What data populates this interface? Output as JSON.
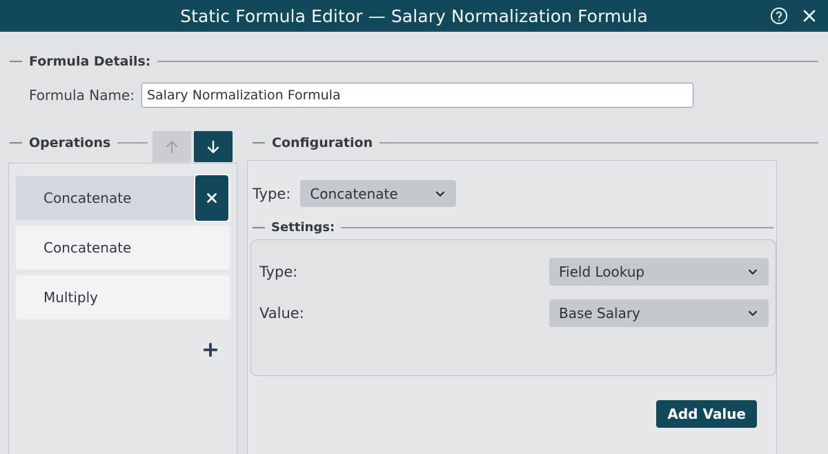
{
  "titlebar": {
    "title": "Static Formula Editor — Salary Normalization Formula",
    "help_icon": "help-circle-icon",
    "close_icon": "close-icon",
    "background": "#11495a",
    "text_color": "#f4f7f8"
  },
  "formula_details": {
    "group_label": "Formula Details:",
    "name_label": "Formula Name:",
    "name_value": "Salary Normalization Formula",
    "name_placeholder": "Formula Name"
  },
  "operations": {
    "group_label": "Operations",
    "move_up": {
      "icon": "arrow-up-icon",
      "enabled": false,
      "background": "#cbcdd0",
      "color": "#9ba1a8"
    },
    "move_down": {
      "icon": "arrow-down-icon",
      "enabled": true,
      "background": "#11495a",
      "color": "#ffffff"
    },
    "items": [
      {
        "label": "Concatenate",
        "selected": true
      },
      {
        "label": "Concatenate",
        "selected": false
      },
      {
        "label": "Multiply",
        "selected": false
      }
    ],
    "delete_icon": "close-icon",
    "add_icon": "plus-icon",
    "selected_background": "#d3d8e0",
    "item_background": "#f2f3f4"
  },
  "configuration": {
    "group_label": "Configuration",
    "type_label": "Type:",
    "type_value": "Concatenate",
    "type_chevron": "chevron-down-icon",
    "settings": {
      "group_label": "Settings:",
      "rows": [
        {
          "label": "Type:",
          "value": "Field Lookup",
          "chevron": "chevron-down-icon"
        },
        {
          "label": "Value:",
          "value": "Base Salary",
          "chevron": "chevron-down-icon"
        }
      ]
    },
    "add_value_label": "Add Value"
  },
  "theme": {
    "accent": "#11495a",
    "page_background": "#e2e3e5",
    "panel_background": "#e5e7e9",
    "select_background": "#c5c8cd"
  }
}
